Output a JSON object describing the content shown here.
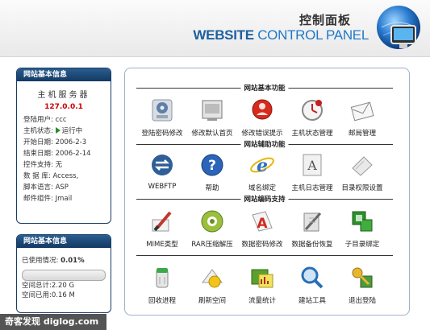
{
  "header": {
    "cn_title": "控制面板",
    "en_title_bold": "WEBSITE",
    "en_title_light": "CONTROL PANEL"
  },
  "server_info": {
    "title": "网站基本信息",
    "server_label": "主机服务器",
    "ip": "127.0.0.1",
    "rows": [
      {
        "key": "登陆用户:",
        "value": "ccc"
      },
      {
        "key": "主机状态:",
        "value": "运行中"
      },
      {
        "key": "开始日期:",
        "value": "2006-2-3"
      },
      {
        "key": "结束日期:",
        "value": "2006-2-14"
      },
      {
        "key": "控件支持:",
        "value": "无"
      },
      {
        "key": "数 据 库:",
        "value": "Access,"
      },
      {
        "key": "脚本语言:",
        "value": "ASP"
      },
      {
        "key": "邮件组件:",
        "value": "Jmail"
      }
    ]
  },
  "space_info": {
    "title": "网站基本信息",
    "usage_label": "已使用情况",
    "usage_value": "0.01%",
    "usage_fraction": 0.0001,
    "total_label": "空间总计:",
    "total_value": "2.20 G",
    "used_label": "空间已用:",
    "used_value": "0.16 M"
  },
  "sections": [
    {
      "title": "网站基本功能",
      "items": [
        {
          "label": "登陆密码修改",
          "icon": "disk-lock-icon"
        },
        {
          "label": "修改默认首页",
          "icon": "window-icon"
        },
        {
          "label": "修改错误提示",
          "icon": "error-icon"
        },
        {
          "label": "主机状态管理",
          "icon": "clock-icon"
        },
        {
          "label": "邮局管理",
          "icon": "mail-icon"
        }
      ]
    },
    {
      "title": "网站辅助功能",
      "items": [
        {
          "label": "WEBFTP",
          "icon": "transfer-icon"
        },
        {
          "label": "帮助",
          "icon": "help-icon"
        },
        {
          "label": "域名绑定",
          "icon": "ie-icon"
        },
        {
          "label": "主机日志管理",
          "icon": "log-document-icon"
        },
        {
          "label": "目录权限设置",
          "icon": "folder-permission-icon"
        }
      ]
    },
    {
      "title": "网站编码支持",
      "items": [
        {
          "label": "MIME类型",
          "icon": "brush-icon"
        },
        {
          "label": "RAR压缩解压",
          "icon": "gear-archive-icon"
        },
        {
          "label": "数据密码修改",
          "icon": "data-password-icon"
        },
        {
          "label": "数据备份恢复",
          "icon": "backup-tools-icon"
        },
        {
          "label": "子目录绑定",
          "icon": "subdirectory-icon"
        }
      ]
    },
    {
      "title": "",
      "items": [
        {
          "label": "回收进程",
          "icon": "recycle-icon"
        },
        {
          "label": "刷新空间",
          "icon": "refresh-icon"
        },
        {
          "label": "流量统计",
          "icon": "chart-icon"
        },
        {
          "label": "建站工具",
          "icon": "magnifier-icon"
        },
        {
          "label": "退出登陆",
          "icon": "keys-exit-icon"
        }
      ]
    }
  ],
  "watermark": "奇客发现 diglog.com",
  "colors": {
    "panel_header": "#1e4a78",
    "ip_red": "#cc0000",
    "title_blue": "#1e5f9e"
  }
}
